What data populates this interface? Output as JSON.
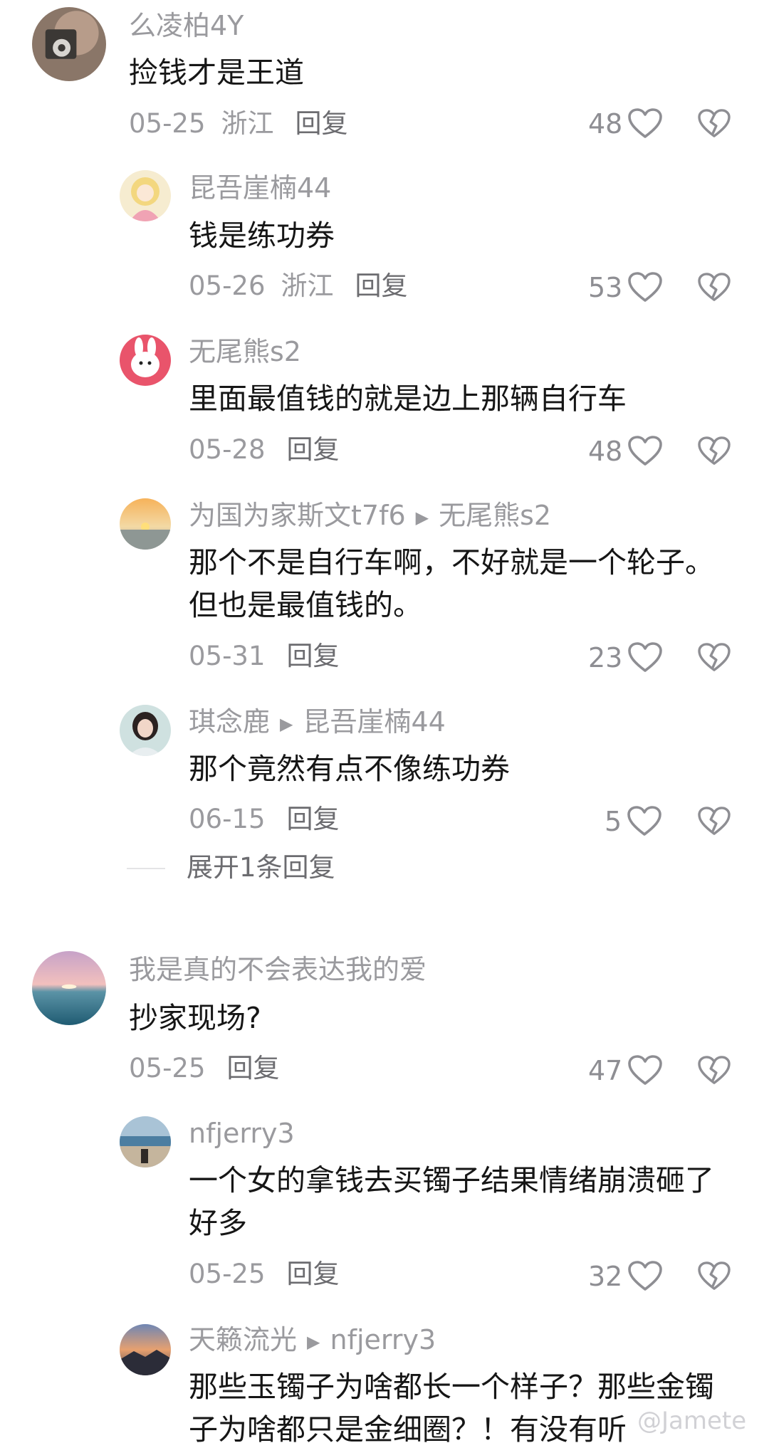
{
  "comments": [
    {
      "user": "么凌柏4Y",
      "text": "捡钱才是王道",
      "date": "05-25",
      "region": "浙江",
      "reply_label": "回复",
      "likes": "48"
    },
    {
      "user": "昆吾崖楠44",
      "text": "钱是练功券",
      "date": "05-26",
      "region": "浙江",
      "reply_label": "回复",
      "likes": "53"
    },
    {
      "user": "无尾熊s2",
      "text": "里面最值钱的就是边上那辆自行车",
      "date": "05-28",
      "reply_label": "回复",
      "likes": "48"
    },
    {
      "user": "为国为家斯文t7f6",
      "reply_to": "无尾熊s2",
      "text": " 那个不是自行车啊，不好就是一个轮子。但也是最值钱的。",
      "date": "05-31",
      "reply_label": "回复",
      "likes": "23"
    },
    {
      "user": "琪念鹿",
      "reply_to": "昆吾崖楠44",
      "text": " 那个竟然有点不像练功券",
      "date": "06-15",
      "reply_label": "回复",
      "likes": "5"
    },
    {
      "user": "我是真的不会表达我的爱",
      "text": "抄家现场?",
      "date": "05-25",
      "reply_label": "回复",
      "likes": "47"
    },
    {
      "user": "nfjerry3",
      "text": "一个女的拿钱去买镯子结果情绪崩溃砸了好多",
      "date": "05-25",
      "reply_label": "回复",
      "likes": "32"
    },
    {
      "user": "天籁流光",
      "reply_to": "nfjerry3",
      "text": " 那些玉镯子为啥都长一个样子？那些金镯子为啥都只是金细圈？！有没有听"
    }
  ],
  "expand_replies": "展开1条回复",
  "watermark": "@Jamete",
  "icons": {
    "like": "heart-outline-icon",
    "dislike": "broken-heart-icon",
    "reply_arrow": "triangle-right-icon"
  },
  "colors": {
    "meta_gray": "#9a9a9e",
    "text": "#161616"
  }
}
